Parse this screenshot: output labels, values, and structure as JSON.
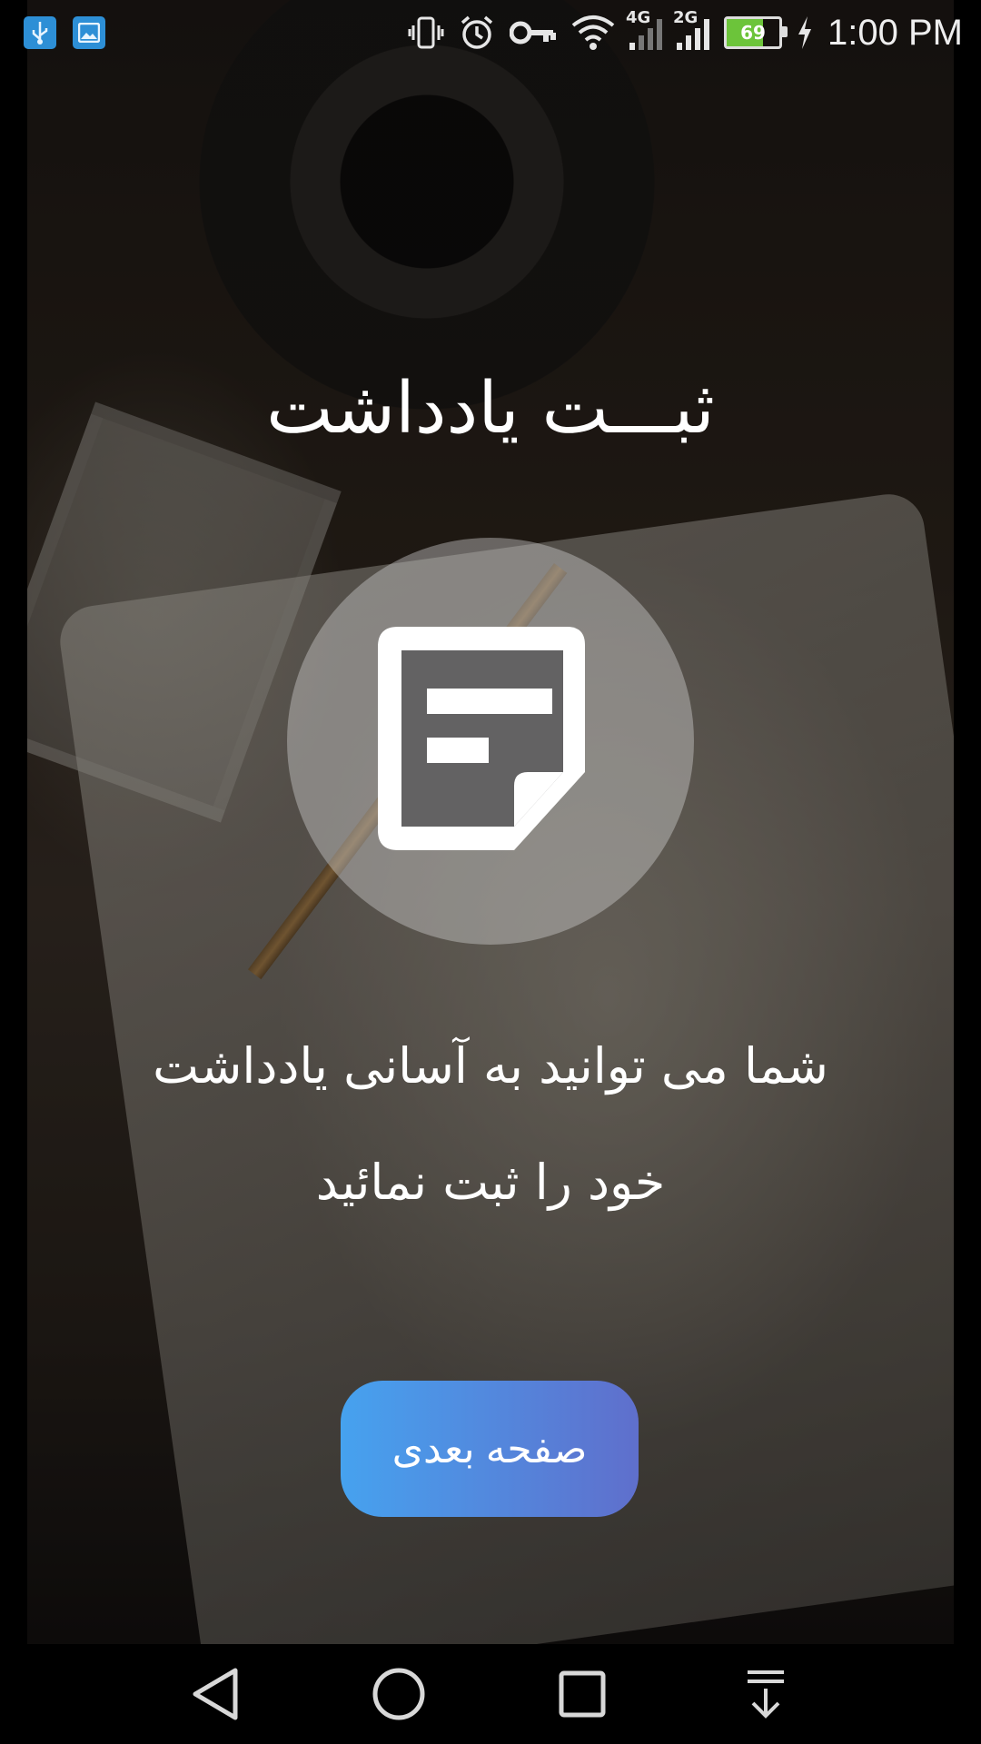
{
  "status_bar": {
    "time": "1:00 PM",
    "battery_level": "69",
    "battery_color": "#6cc43a",
    "network_4g": "4G",
    "network_2g": "2G",
    "left_icons": [
      "usb-icon",
      "gallery-icon"
    ],
    "right_icons": [
      "vibrate-icon",
      "alarm-icon",
      "vpn-key-icon",
      "wifi-icon",
      "signal-4g-icon",
      "signal-2g-icon",
      "battery-icon",
      "charging-icon"
    ]
  },
  "onboarding": {
    "title": "ثبـــت یادداشت",
    "icon": "note-icon",
    "description_line1": "شما می توانید به آسانی یادداشت",
    "description_line2": "خود را ثبت نمائید",
    "next_button": "صفحه بعدی",
    "button_gradient": [
      "#46a2ef",
      "#5f6fcc"
    ]
  },
  "nav_bar": {
    "buttons": [
      "back-icon",
      "home-icon",
      "recents-icon",
      "notification-pull-icon"
    ]
  }
}
